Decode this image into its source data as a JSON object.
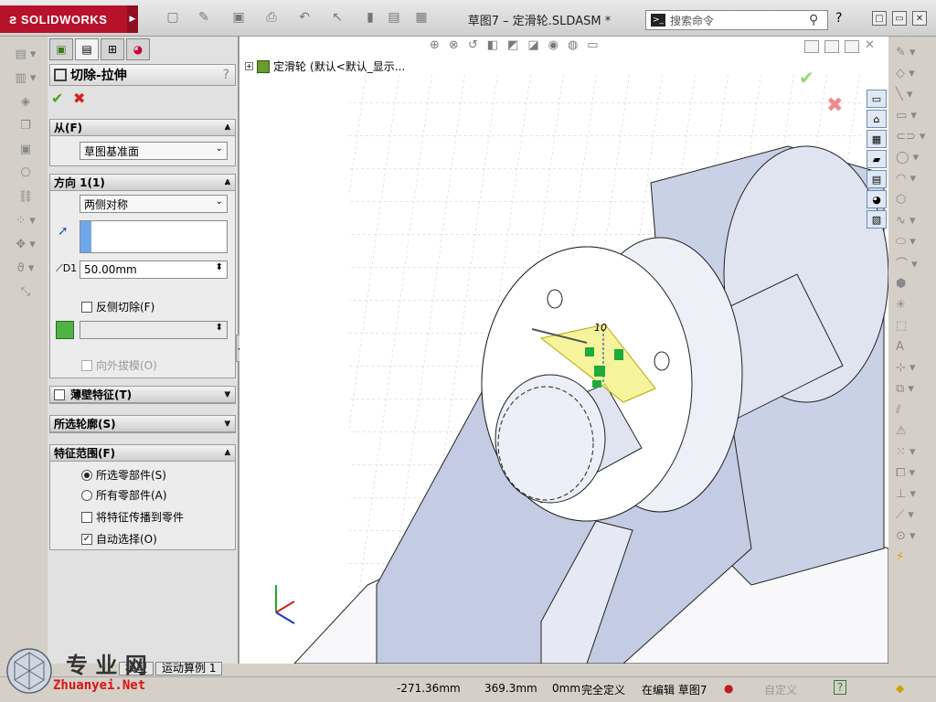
{
  "app": {
    "brand": "SOLIDWORKS",
    "doc_title": "草图7 – 定滑轮.SLDASM *"
  },
  "search": {
    "placeholder": "搜索命令"
  },
  "window": {
    "help": "?",
    "min": "□",
    "restore": "▭",
    "close": "✕"
  },
  "property_manager": {
    "title": "切除-拉伸",
    "help": "?",
    "ok": "✔",
    "cancel": "✖",
    "from": {
      "header": "从(F)",
      "value": "草图基准面"
    },
    "direction1": {
      "header": "方向 1(1)",
      "end_condition": "两侧对称",
      "depth": "50.00mm",
      "flip_label": "反侧切除(F)",
      "draft_label": "向外拔模(O)"
    },
    "thin": {
      "header": "薄壁特征(T)"
    },
    "contours": {
      "header": "所选轮廓(S)"
    },
    "scope": {
      "header": "特征范围(F)",
      "opt_selected": "所选零部件(S)",
      "opt_all": "所有零部件(A)",
      "propagate": "将特征传播到零件",
      "auto_select": "自动选择(O)"
    }
  },
  "tree": {
    "root": "定滑轮",
    "config": "(默认<默认_显示..."
  },
  "viewport": {
    "dim_label": "10"
  },
  "bottom_tabs": [
    "模型",
    "运动算例 1"
  ],
  "status": {
    "x": "-271.36mm",
    "y": "369.3mm",
    "z": "0mm",
    "state": "完全定义",
    "editing": "在编辑 草图7",
    "custom": "自定义",
    "help": "?"
  },
  "watermark": {
    "text": "专 业 网",
    "url": "Zhuanyei.Net"
  },
  "colors": {
    "brand": "#b8122b",
    "accent_green": "#4fa326",
    "cancel_red": "#d42020",
    "model_blue": "#c9d1e6",
    "highlight_yellow": "#f2ef79"
  }
}
